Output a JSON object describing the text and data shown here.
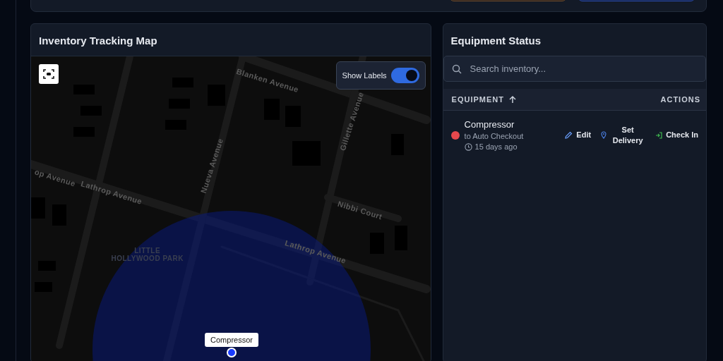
{
  "map_panel": {
    "title": "Inventory Tracking Map",
    "show_labels": {
      "label": "Show Labels",
      "on": true
    },
    "map_labels": [
      {
        "text": "Blanken Avenue",
        "kind": "street"
      },
      {
        "text": "Gillette Avenue",
        "kind": "street"
      },
      {
        "text": "op Avenue",
        "kind": "street"
      },
      {
        "text": "Lathrop Avenue",
        "kind": "street"
      },
      {
        "text": "Nueva Avenue",
        "kind": "street"
      },
      {
        "text": "Nibbi Court",
        "kind": "street"
      },
      {
        "text": "LITTLE\nHOLLYWOOD PARK",
        "kind": "park"
      },
      {
        "text": "Lathrop Avenue",
        "kind": "street"
      }
    ],
    "markers": [
      {
        "label": "Compressor"
      }
    ]
  },
  "equipment_panel": {
    "title": "Equipment Status",
    "search": {
      "placeholder": "Search inventory..."
    },
    "columns": [
      {
        "label": "EQUIPMENT",
        "sorted": true
      },
      {
        "label": "ACTIONS"
      }
    ],
    "rows": [
      {
        "name": "Compressor",
        "detail": "to Auto Checkout",
        "time": "15 days ago",
        "color": "#e5484d",
        "actions": [
          {
            "label": "Edit",
            "kind": "edit"
          },
          {
            "label": "Set Delivery",
            "kind": "delivery"
          },
          {
            "label": "Check In",
            "kind": "checkin"
          }
        ]
      }
    ]
  }
}
